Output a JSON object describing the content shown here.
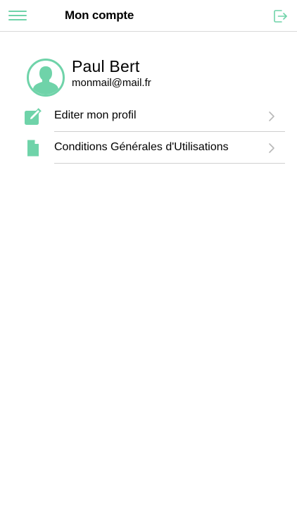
{
  "header": {
    "title": "Mon compte",
    "menu_icon": "hamburger-menu-icon",
    "logout_icon": "logout-icon"
  },
  "profile": {
    "name": "Paul Bert",
    "email": "monmail@mail.fr",
    "avatar_icon": "user-avatar-icon"
  },
  "menu_items": [
    {
      "label": "Editer mon profil",
      "icon": "edit-icon"
    },
    {
      "label": "Conditions Générales d'Utilisations",
      "icon": "document-icon"
    }
  ],
  "colors": {
    "accent": "#6fd3a9",
    "separator": "#cfcfcf",
    "chevron": "#b8b8b8"
  }
}
